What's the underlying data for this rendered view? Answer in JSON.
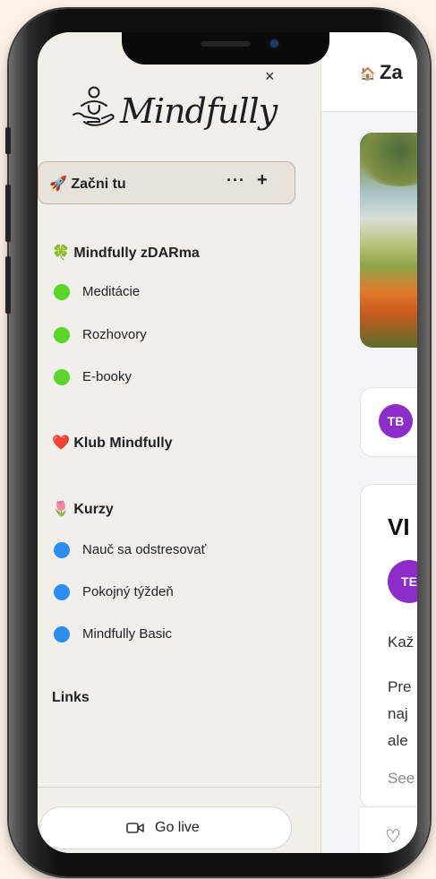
{
  "app": {
    "brand": "Mindfully"
  },
  "main": {
    "header_title": "Za",
    "card1_avatar": "TB",
    "card2": {
      "title": "VI",
      "avatar": "TE",
      "line1": "Kaž",
      "line2": "Pre",
      "line3": "naj",
      "line4": "ale",
      "see_more": "See"
    }
  },
  "drawer": {
    "close_symbol": "×",
    "start": {
      "label": "🚀 Začni tu",
      "more": "···",
      "add": "+"
    },
    "sections": [
      {
        "title": "🍀 Mindfully zDARma",
        "items": [
          "Meditácie",
          "Rozhovory",
          "E-booky"
        ]
      },
      {
        "title": "❤️ Klub Mindfully",
        "items": []
      },
      {
        "title": "🌷 Kurzy",
        "items": [
          "Nauč sa odstresovať",
          "Pokojný týždeň",
          "Mindfully Basic"
        ]
      },
      {
        "title": "Links",
        "items": []
      }
    ],
    "go_live": "Go live"
  },
  "colors": {
    "green_dot": "#5ad62a",
    "blue_dot": "#2a8ef0",
    "avatar_purple": "#8c2dc9",
    "drawer_bg": "#f1efea"
  },
  "icons": {
    "home": "house-icon",
    "close": "close-icon",
    "video": "video-camera-icon",
    "heart": "heart-icon"
  }
}
